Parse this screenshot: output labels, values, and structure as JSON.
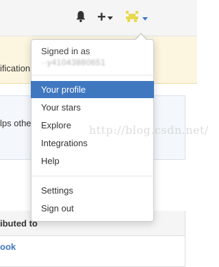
{
  "header": {
    "icons": [
      "bell-icon",
      "plus-icon",
      "avatar-icon"
    ],
    "plus_label": "+"
  },
  "background": {
    "notice_text": "ification",
    "panel_text": "lps othe",
    "contributed_title": "ibuted to",
    "contributed_link": "ook"
  },
  "dropdown": {
    "signed_in_label": "Signed in as",
    "username": "··y41043880651",
    "items": [
      {
        "label": "Your profile",
        "active": true
      },
      {
        "label": "Your stars",
        "active": false
      },
      {
        "label": "Explore",
        "active": false
      },
      {
        "label": "Integrations",
        "active": false
      },
      {
        "label": "Help",
        "active": false
      },
      {
        "label": "Settings",
        "active": false
      },
      {
        "label": "Sign out",
        "active": false
      }
    ]
  },
  "watermark": "http://blog.csdn.net/",
  "colors": {
    "active_bg": "#4078c0",
    "avatar": "#e8d84c",
    "notice_bg": "#fcf6e0"
  }
}
